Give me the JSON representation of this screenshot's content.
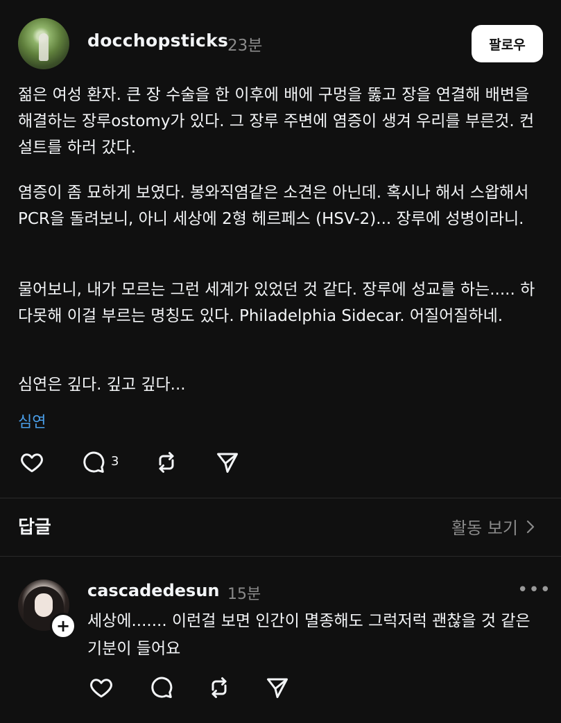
{
  "post": {
    "username": "docchopsticks",
    "time": "23분",
    "follow_label": "팔로우",
    "paragraphs": [
      "젊은 여성 환자. 큰 장 수술을 한 이후에 배에 구멍을 뚫고 장을 연결해 배변을 해결하는 장루ostomy가 있다. 그 장루 주변에 염증이 생겨 우리를 부른것. 컨설트를 하러 갔다.",
      "염증이 좀 묘하게 보였다. 봉와직염같은 소견은 아닌데. 혹시나 해서 스왑해서 PCR을 돌려보니, 아니 세상에 2형 헤르페스 (HSV-2)... 장루에 성병이라니.",
      "물어보니, 내가 모르는 그런 세계가 있었던 것 같다. 장루에 성교를 하는..... 하다못해 이걸 부르는 명칭도 있다. Philadelphia Sidecar. 어질어질하네.",
      "심연은 깊다. 깊고 깊다..."
    ],
    "tag": "심연",
    "comment_count": "3",
    "icons": [
      "heart-icon",
      "comment-icon",
      "repost-icon",
      "share-icon"
    ]
  },
  "replies_section": {
    "title": "답글",
    "activity_label": "활동 보기"
  },
  "reply": {
    "username": "cascadedesun",
    "time": "15분",
    "text": "세상에....... 이런걸 보면 인간이 멸종해도 그럭저럭 괜찮을 것 같은 기분이 들어요",
    "plus": "+",
    "more": "•••"
  },
  "colors": {
    "background": "#101010",
    "text": "#f3f5f7",
    "muted": "#8a8a8a",
    "tag": "#4a9ee8"
  }
}
